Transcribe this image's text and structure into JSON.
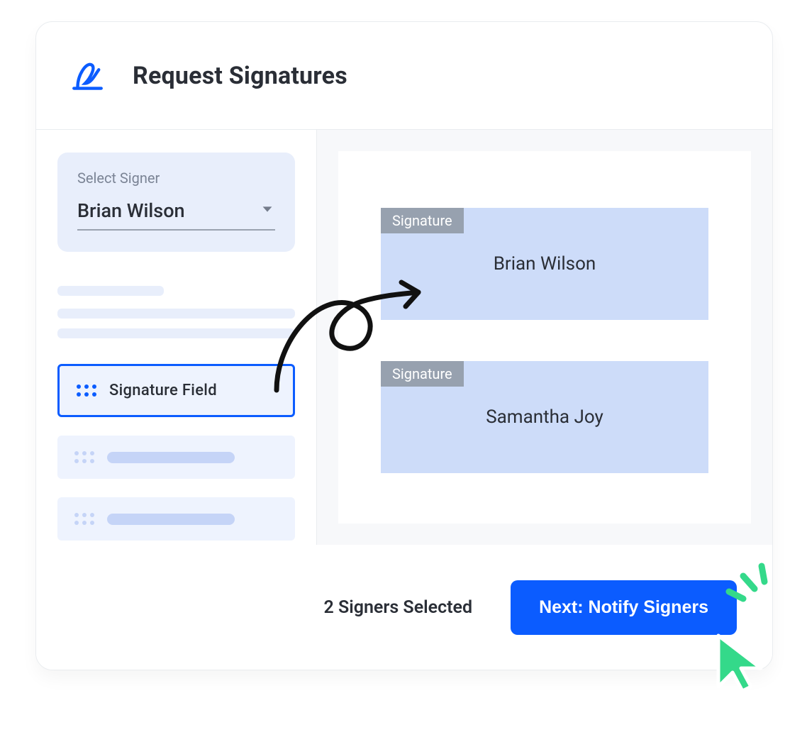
{
  "header": {
    "title": "Request Signatures"
  },
  "sidebar": {
    "select_label": "Select Signer",
    "selected_signer": "Brian Wilson",
    "field_active_label": "Signature Field"
  },
  "canvas": {
    "tag_label": "Signature",
    "boxes": [
      {
        "name": "Brian Wilson"
      },
      {
        "name": "Samantha Joy"
      }
    ]
  },
  "footer": {
    "status": "2 Signers Selected",
    "cta": "Next: Notify Signers"
  },
  "colors": {
    "accent": "#0b5cff",
    "box": "#cddcf9",
    "tag": "#97a1af",
    "cursor": "#34d98a"
  }
}
